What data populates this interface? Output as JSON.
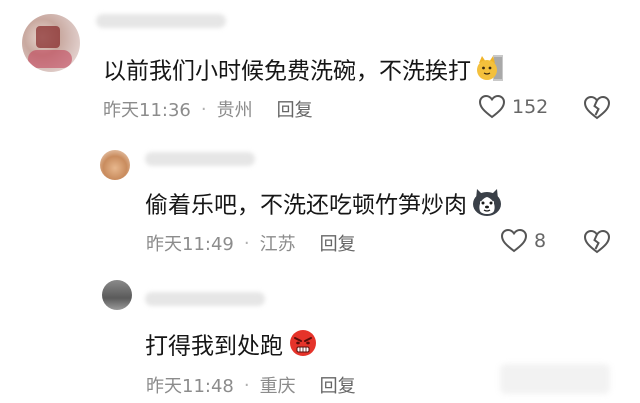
{
  "comments": [
    {
      "text": "以前我们小时候免费洗碗，不洗挨打",
      "emoji": "cat-emoji",
      "time": "昨天11:36",
      "location": "贵州",
      "reply_label": "回复",
      "likes": "152"
    }
  ],
  "replies": [
    {
      "text": "偷着乐吧，不洗还吃顿竹笋炒肉",
      "emoji": "husky-emoji",
      "time": "昨天11:49",
      "location": "江苏",
      "reply_label": "回复",
      "likes": "8"
    },
    {
      "text": "打得我到处跑",
      "emoji": "angry-face-emoji",
      "time": "昨天11:48",
      "location": "重庆",
      "reply_label": "回复"
    }
  ],
  "separator": "·",
  "colors": {
    "meta": "#8c8c8c",
    "reply": "#666666",
    "angry_red": "#e5332a"
  }
}
